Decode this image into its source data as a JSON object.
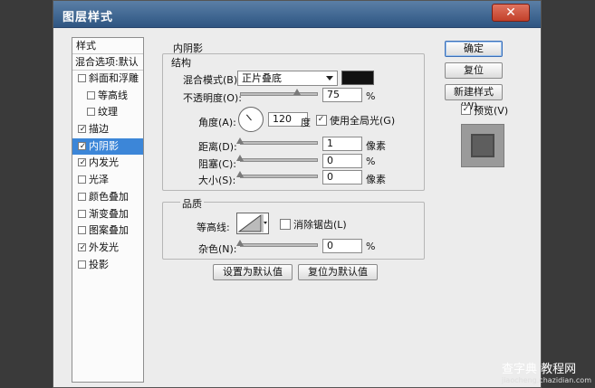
{
  "window": {
    "title": "图层样式",
    "close": "✕"
  },
  "stylelist": {
    "header": "样式",
    "blend": "混合选项:默认",
    "items": [
      {
        "label": "斜面和浮雕",
        "checked": false,
        "indent": false,
        "selected": false
      },
      {
        "label": "等高线",
        "checked": false,
        "indent": true,
        "selected": false
      },
      {
        "label": "纹理",
        "checked": false,
        "indent": true,
        "selected": false
      },
      {
        "label": "描边",
        "checked": true,
        "indent": false,
        "selected": false
      },
      {
        "label": "内阴影",
        "checked": true,
        "indent": false,
        "selected": true
      },
      {
        "label": "内发光",
        "checked": true,
        "indent": false,
        "selected": false
      },
      {
        "label": "光泽",
        "checked": false,
        "indent": false,
        "selected": false
      },
      {
        "label": "颜色叠加",
        "checked": false,
        "indent": false,
        "selected": false
      },
      {
        "label": "渐变叠加",
        "checked": false,
        "indent": false,
        "selected": false
      },
      {
        "label": "图案叠加",
        "checked": false,
        "indent": false,
        "selected": false
      },
      {
        "label": "外发光",
        "checked": true,
        "indent": false,
        "selected": false
      },
      {
        "label": "投影",
        "checked": false,
        "indent": false,
        "selected": false
      }
    ]
  },
  "inner_shadow": {
    "title": "内阴影",
    "structure": {
      "title": "结构",
      "blend_label": "混合模式(B):",
      "blend_value": "正片叠底",
      "opacity_label": "不透明度(O):",
      "opacity_value": "75",
      "opacity_unit": "%",
      "angle_label": "角度(A):",
      "angle_value": "120",
      "angle_unit": "度",
      "global_light": "使用全局光(G)",
      "distance_label": "距离(D):",
      "distance_value": "1",
      "distance_unit": "像素",
      "choke_label": "阻塞(C):",
      "choke_value": "0",
      "choke_unit": "%",
      "size_label": "大小(S):",
      "size_value": "0",
      "size_unit": "像素"
    },
    "quality": {
      "title": "品质",
      "contour_label": "等高线:",
      "antialias": "消除锯齿(L)",
      "noise_label": "杂色(N):",
      "noise_value": "0",
      "noise_unit": "%"
    },
    "set_default": "设置为默认值",
    "reset_default": "复位为默认值"
  },
  "buttons": {
    "ok": "确定",
    "reset": "复位",
    "new_style": "新建样式(W)...",
    "preview": "预览(V)"
  },
  "watermark": {
    "text": "查字典 教程网",
    "sub": "jiaocheng.chazidian.com"
  },
  "colors": {
    "accent": "#3c86d8",
    "titlebar": "#3f6691"
  }
}
